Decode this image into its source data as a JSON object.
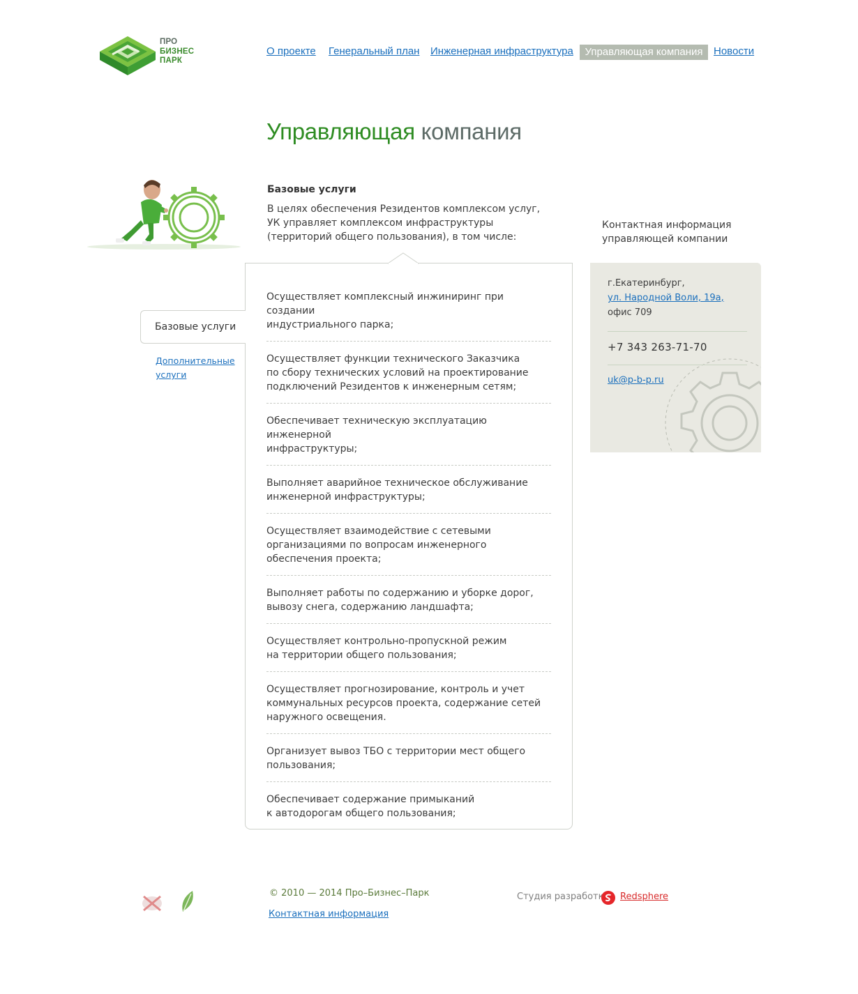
{
  "logo": {
    "line1": "ПРО",
    "line2": "БИЗНЕС",
    "line3": "ПАРК"
  },
  "nav": {
    "items": [
      {
        "label": "О проекте"
      },
      {
        "label": "Генеральный план"
      },
      {
        "label": "Инженерная инфраструктура"
      },
      {
        "label": "Управляющая компания",
        "active": true
      },
      {
        "label": "Новости"
      }
    ]
  },
  "page": {
    "title_part1": "Управляющая",
    "title_part2": "компания"
  },
  "intro": {
    "heading": "Базовые услуги",
    "text": "В целях обеспечения Резидентов комплексом услуг,\nУК управляет комплексом инфраструктуры\n(территорий общего пользования), в том числе:"
  },
  "tabs": {
    "active": "Базовые услуги",
    "other": "Дополнительные услуги"
  },
  "services": [
    "Осуществляет комплексный инжиниринг при создании\nиндустриального парка;",
    "Осуществляет функции технического Заказчика\nпо сбору технических условий на проектирование\nподключений Резидентов к инженерным сетям;",
    "Обеспечивает техническую эксплуатацию инженерной\nинфраструктуры;",
    "Выполняет аварийное техническое обслуживание\nинженерной инфраструктуры;",
    "Осуществляет взаимодействие с сетевыми\nорганизациями по вопросам инженерного\nобеспечения проекта;",
    "Выполняет работы по содержанию и уборке дорог,\nвывозу снега, содержанию ландшафта;",
    "Осуществляет контрольно-пропускной режим\nна территории общего пользования;",
    "Осуществляет прогнозирование, контроль и учет\nкоммунальных ресурсов проекта, содержание сетей\nнаружного освещения.",
    "Организует вывоз ТБО с территории мест общего\nпользования;",
    "Обеспечивает содержание примыканий\nк автодорогам общего пользования;"
  ],
  "contact": {
    "heading": "Контактная информация\nуправляющей компании",
    "city": "г.Екатеринбург,",
    "street": "ул. Народной Воли, 19а,",
    "office": "офис 709",
    "phone": "+7 343 263-71-70",
    "email": "uk@p-b-p.ru"
  },
  "footer": {
    "copyright": "© 2010 — 2014 Про–Бизнес–Парк",
    "contact_link": "Контактная информация",
    "studio_label": "Студия разработк",
    "studio_name": "Redsphere"
  },
  "colors": {
    "brand_green": "#2e8c22",
    "title_grey": "#5d6b67",
    "link_blue": "#1a6fbd",
    "active_nav_bg": "#b4bbb0",
    "contact_bg": "#e9e9e2",
    "studio_red": "#d82b2b"
  }
}
